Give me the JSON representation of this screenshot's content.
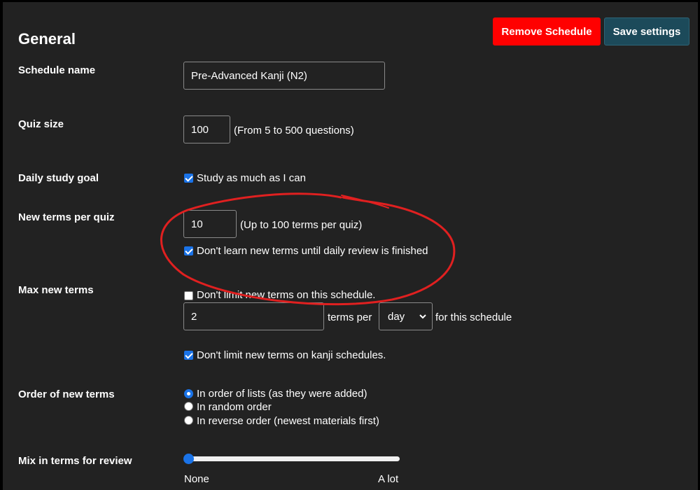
{
  "header": {
    "title": "General",
    "remove_label": "Remove Schedule",
    "save_label": "Save settings"
  },
  "schedule_name": {
    "label": "Schedule name",
    "value": "Pre-Advanced Kanji (N2)"
  },
  "quiz_size": {
    "label": "Quiz size",
    "value": "100",
    "hint": "(From 5 to 500 questions)"
  },
  "daily_goal": {
    "label": "Daily study goal",
    "checkbox_label": "Study as much as I can",
    "checked": true
  },
  "new_terms": {
    "label": "New terms per quiz",
    "value": "10",
    "hint": "(Up to 100 terms per quiz)",
    "checkbox_label": "Don't learn new terms until daily review is finished",
    "checked": true
  },
  "max_new_terms": {
    "label": "Max new terms",
    "no_limit_label": "Don't limit new terms on this schedule.",
    "no_limit_checked": false,
    "value": "2",
    "terms_per": "terms per",
    "period": "day",
    "suffix": "for this schedule",
    "kanji_label": "Don't limit new terms on kanji schedules.",
    "kanji_checked": true
  },
  "order": {
    "label": "Order of new terms",
    "options": [
      {
        "label": "In order of lists (as they were added)",
        "selected": true
      },
      {
        "label": "In random order",
        "selected": false
      },
      {
        "label": "In reverse order (newest materials first)",
        "selected": false
      }
    ]
  },
  "mix": {
    "label": "Mix in terms for review",
    "min_label": "None",
    "max_label": "A lot",
    "level": 0
  },
  "colors": {
    "accent": "#1a73e8",
    "danger": "#ff0000",
    "save": "#1c4a5a",
    "annotation": "#e02020"
  },
  "icons": {
    "select_arrow": "chevron-down-icon"
  }
}
